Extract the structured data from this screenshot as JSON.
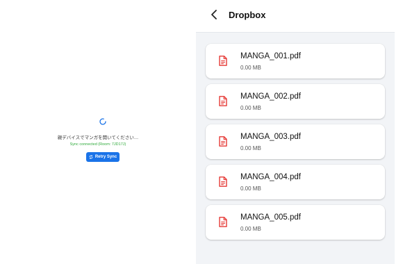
{
  "left_panel": {
    "sync_message": "親デバイスでマンガを開いてください…",
    "sync_status": "Sync connected (Room: 7JD17J)",
    "retry_label": "Retry Sync"
  },
  "header": {
    "title": "Dropbox",
    "back_icon": "chevron-left-icon"
  },
  "files": [
    {
      "name": "MANGA_001.pdf",
      "size": "0.00 MB",
      "icon": "pdf-file-icon"
    },
    {
      "name": "MANGA_002.pdf",
      "size": "0.00 MB",
      "icon": "pdf-file-icon"
    },
    {
      "name": "MANGA_003.pdf",
      "size": "0.00 MB",
      "icon": "pdf-file-icon"
    },
    {
      "name": "MANGA_004.pdf",
      "size": "0.00 MB",
      "icon": "pdf-file-icon"
    },
    {
      "name": "MANGA_005.pdf",
      "size": "0.00 MB",
      "icon": "pdf-file-icon"
    }
  ],
  "colors": {
    "accent": "#1a73e8",
    "status_green": "#2eaa3a",
    "file_icon_red": "#e53935",
    "list_background": "#f2f4f7"
  }
}
